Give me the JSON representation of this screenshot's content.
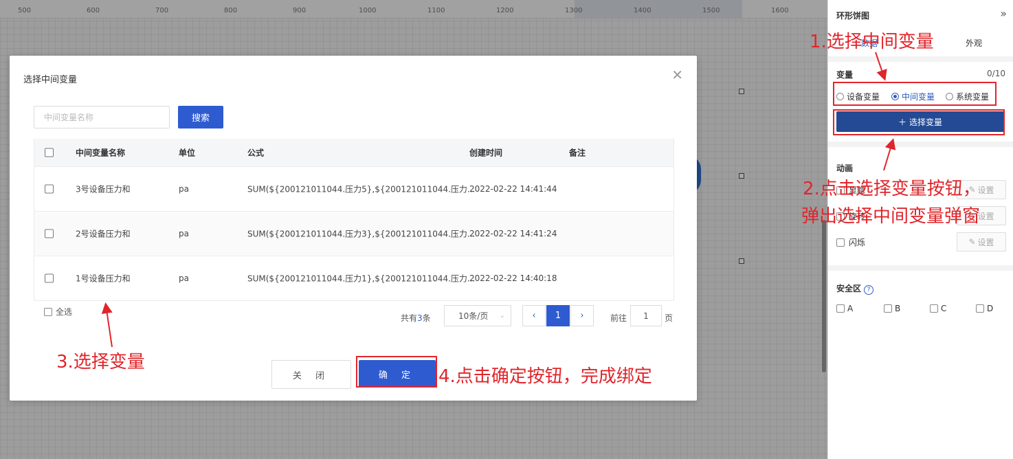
{
  "ruler": {
    "ticks": [
      "500",
      "600",
      "700",
      "800",
      "900",
      "1000",
      "1100",
      "1200",
      "1300",
      "1400",
      "1500",
      "1600"
    ]
  },
  "modal": {
    "title": "选择中间变量",
    "search_placeholder": "中间变量名称",
    "search_button": "搜索",
    "columns": [
      "中间变量名称",
      "单位",
      "公式",
      "创建时间",
      "备注"
    ],
    "rows": [
      {
        "name": "3号设备压力和",
        "unit": "pa",
        "formula": "SUM(${200121011044.压力5},${200121011044.压力...",
        "created": "2022-02-22 14:41:44",
        "note": ""
      },
      {
        "name": "2号设备压力和",
        "unit": "pa",
        "formula": "SUM(${200121011044.压力3},${200121011044.压力...",
        "created": "2022-02-22 14:41:24",
        "note": ""
      },
      {
        "name": "1号设备压力和",
        "unit": "pa",
        "formula": "SUM(${200121011044.压力1},${200121011044.压力...",
        "created": "2022-02-22 14:40:18",
        "note": ""
      }
    ],
    "select_all": "全选",
    "pagination": {
      "total_prefix": "共有",
      "total": "3",
      "total_suffix": "条",
      "page_size": "10条/页",
      "current_page": "1",
      "goto_label": "前往",
      "goto_value": "1",
      "page_unit": "页"
    },
    "close_button": "关 闭",
    "ok_button": "确 定"
  },
  "panel": {
    "title": "环形饼图",
    "tabs": [
      "数据",
      "外观"
    ],
    "variable_label": "变量",
    "variable_count": "0/10",
    "radios": [
      {
        "label": "设备变量",
        "checked": false
      },
      {
        "label": "中间变量",
        "checked": true
      },
      {
        "label": "系统变量",
        "checked": false
      }
    ],
    "select_button": "选择变量",
    "animation_label": "动画",
    "animations": [
      {
        "label": "显隐",
        "set": "设置"
      },
      {
        "label": "旋转",
        "set": "设置"
      },
      {
        "label": "闪烁",
        "set": "设置"
      }
    ],
    "safe_area_label": "安全区",
    "safe_options": [
      "A",
      "B",
      "C",
      "D"
    ]
  },
  "annotations": {
    "step1": "1.选择中间变量",
    "step2_line1": "2.点击选择变量按钮，",
    "step2_line2": "弹出选择中间变量弹窗",
    "step3": "3.选择变量",
    "step4": "4.点击确定按钮，完成绑定"
  },
  "colors": {
    "primary": "#2e5bd0",
    "annotation": "#e0252b",
    "panel_button": "#244a94"
  }
}
